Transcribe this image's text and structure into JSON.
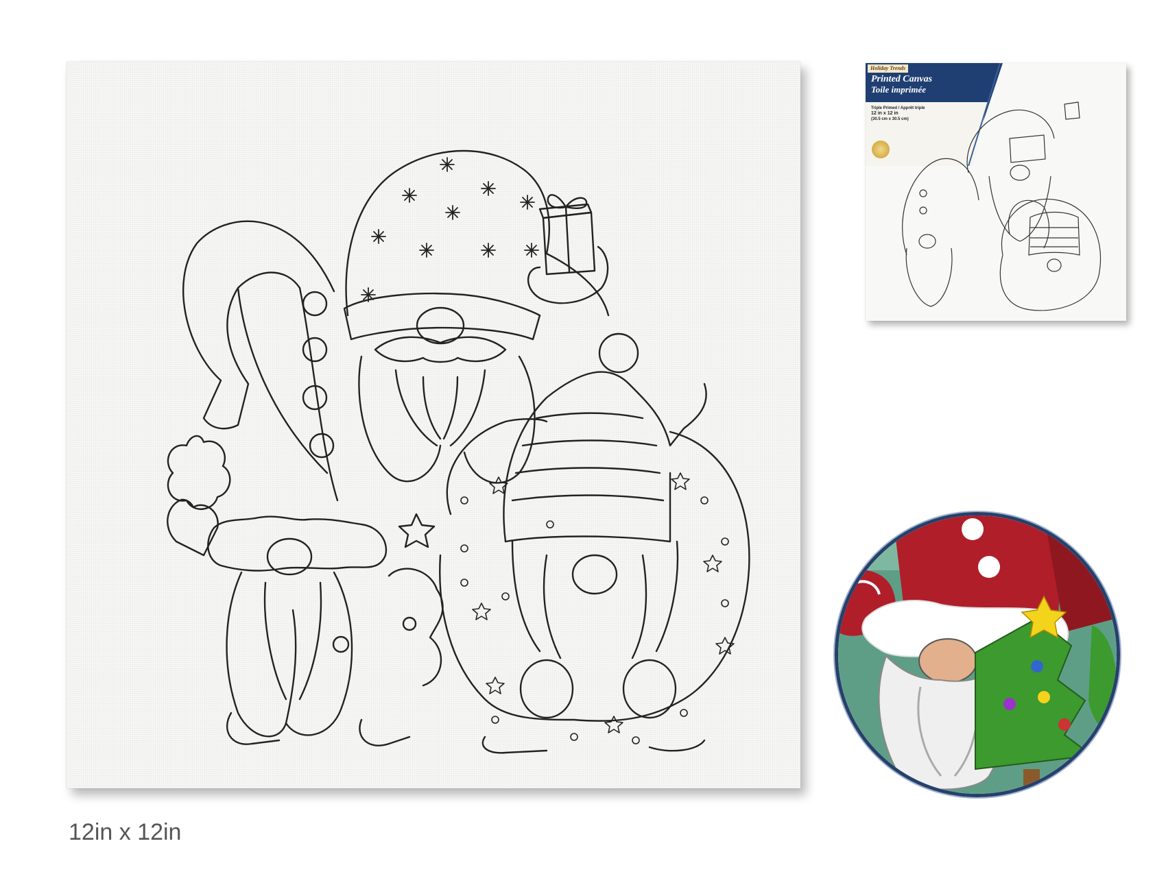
{
  "caption": "12in x 12in",
  "package": {
    "brand": "Holiday Trends",
    "title_en": "Printed Canvas",
    "title_fr": "Toile imprimée",
    "primed": "Triple Primed / Apprêt triple",
    "size_in": "12 in x 12 in",
    "size_cm": "(30.5 cm x 30.5 cm)",
    "accent_color": "#1f3f73"
  },
  "icons": {
    "main_artwork": "gnome-trio-outline-icon",
    "package_artwork": "gnome-trio-thumbnail-icon",
    "detail_artwork": "painted-gnome-closeup-icon",
    "seal": "quality-seal-icon"
  },
  "colors": {
    "detail_hat": "#b01e2a",
    "detail_tree": "#3c9a2e",
    "detail_background": "#5f9e86",
    "detail_star": "#f4d31c",
    "detail_border": "#27406b"
  }
}
